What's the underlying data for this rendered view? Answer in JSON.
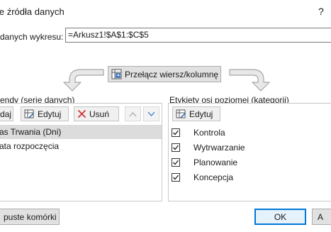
{
  "dialog": {
    "title": "ie źródła danych",
    "help": "?"
  },
  "range": {
    "label": "danych wykresu:",
    "value": "=Arkusz1!$A$1:$C$5"
  },
  "switch_button": {
    "label": "Przełącz wiersz/kolumnę",
    "icon": "switch-rows-columns-icon"
  },
  "legend": {
    "section_label": "endy (serie danych)",
    "add_label": "daj",
    "edit_label": "Edytuj",
    "remove_label": "Usuń",
    "items": [
      {
        "label": "as Trwania (Dni)",
        "selected": true
      },
      {
        "label": "ata rozpoczęcia",
        "selected": false
      }
    ]
  },
  "categories": {
    "section_label": "Etykiety osi poziomej (kategorii)",
    "edit_label": "Edytuj",
    "items": [
      {
        "label": "Kontrola",
        "checked": true
      },
      {
        "label": "Wytrwarzanie",
        "checked": true
      },
      {
        "label": "Planowanie",
        "checked": true
      },
      {
        "label": "Koncepcja",
        "checked": true
      }
    ]
  },
  "footer": {
    "hidden_cells_label": "puste komórki",
    "ok_label": "OK",
    "cancel_label": "A"
  },
  "colors": {
    "accent": "#0078d7",
    "remove_icon": "#d13438",
    "edit_icon": "#1e5fa8",
    "arrow_fill": "#e8e8e8",
    "arrow_stroke": "#a6a6a6"
  }
}
